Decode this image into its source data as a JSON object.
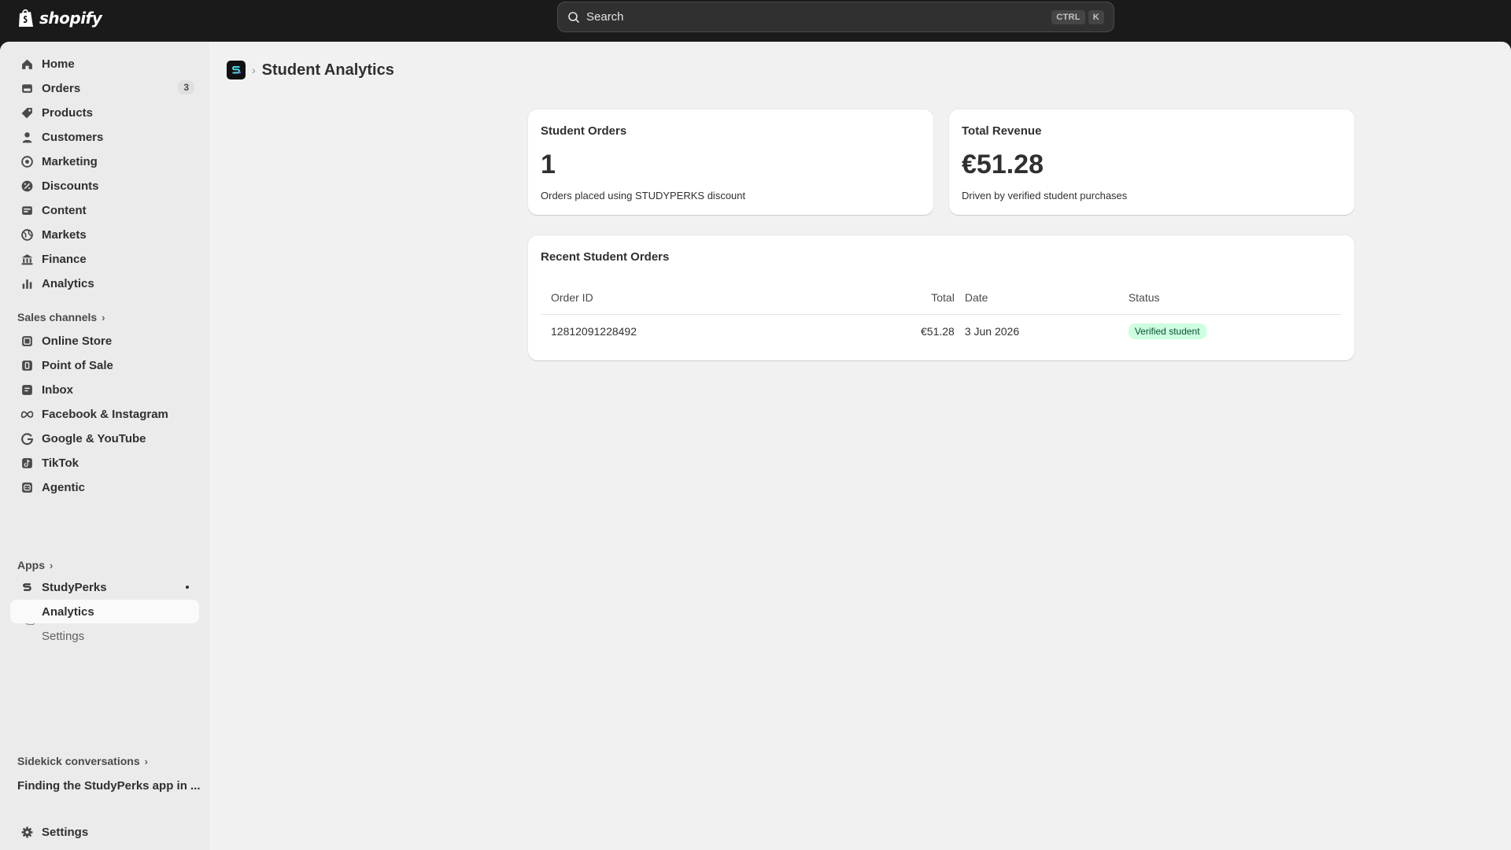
{
  "topbar": {
    "logo_text": "shopify",
    "search_placeholder": "Search",
    "shortcut_keys": [
      "CTRL",
      "K"
    ]
  },
  "sidebar": {
    "main_items": [
      {
        "label": "Home",
        "icon": "home-icon"
      },
      {
        "label": "Orders",
        "icon": "orders-icon",
        "badge": "3"
      },
      {
        "label": "Products",
        "icon": "tag-icon"
      },
      {
        "label": "Customers",
        "icon": "person-icon"
      },
      {
        "label": "Marketing",
        "icon": "target-icon"
      },
      {
        "label": "Discounts",
        "icon": "discount-icon"
      },
      {
        "label": "Content",
        "icon": "content-icon"
      },
      {
        "label": "Markets",
        "icon": "globe-icon"
      },
      {
        "label": "Finance",
        "icon": "bank-icon"
      },
      {
        "label": "Analytics",
        "icon": "bar-chart-icon"
      }
    ],
    "sales_channels_label": "Sales channels",
    "channels": [
      {
        "label": "Online Store",
        "icon": "store-icon"
      },
      {
        "label": "Point of Sale",
        "icon": "pos-icon"
      },
      {
        "label": "Inbox",
        "icon": "inbox-icon"
      },
      {
        "label": "Facebook & Instagram",
        "icon": "meta-icon"
      },
      {
        "label": "Google & YouTube",
        "icon": "google-icon"
      },
      {
        "label": "TikTok",
        "icon": "tiktok-icon"
      },
      {
        "label": "Agentic",
        "icon": "agentic-icon"
      }
    ],
    "apps_label": "Apps",
    "app": {
      "label": "StudyPerks",
      "icon": "studyperks-icon"
    },
    "app_subitems": [
      {
        "label": "Analytics"
      },
      {
        "label": "Settings"
      }
    ],
    "sidekick_label": "Sidekick conversations",
    "conversation": "Finding the StudyPerks app in ...",
    "settings_label": "Settings"
  },
  "page": {
    "title": "Student Analytics"
  },
  "stats": {
    "orders": {
      "title": "Student Orders",
      "value": "1",
      "description": "Orders placed using STUDYPERKS discount"
    },
    "revenue": {
      "title": "Total Revenue",
      "value": "€51.28",
      "description": "Driven by verified student purchases"
    }
  },
  "recent_orders": {
    "title": "Recent Student Orders",
    "columns": {
      "order_id": "Order ID",
      "total": "Total",
      "date": "Date",
      "status": "Status"
    },
    "rows": [
      {
        "order_id": "12812091228492",
        "total": "€51.28",
        "date": "3 Jun 2026",
        "status": "Verified student"
      }
    ]
  },
  "colors": {
    "topbar": "#1a1a1a",
    "sidebar": "#ebebeb",
    "background": "#f1f1f1",
    "status_badge_bg": "#cdfee1",
    "status_badge_text": "#0c5132"
  }
}
